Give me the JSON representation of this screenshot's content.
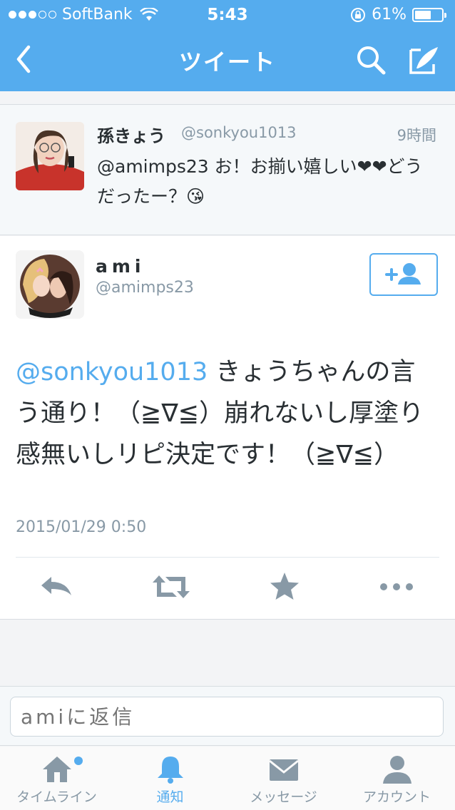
{
  "status_bar": {
    "carrier": "SoftBank",
    "time": "5:43",
    "battery": "61%",
    "battery_level": 0.61
  },
  "nav": {
    "title": "ツイート"
  },
  "reply_tweet": {
    "name": "孫きょう",
    "handle": "@sonkyou1013",
    "time": "9時間",
    "text": "@amimps23 お！お揃い嬉しい❤❤どうだったー？😘"
  },
  "main_tweet": {
    "name": "ami",
    "handle": "@amimps23",
    "mention": "@sonkyou1013",
    "text": " きょうちゃんの言う通り！（≧∇≦）崩れないし厚塗り感無いしリピ決定です！（≧∇≦）",
    "date": "2015/01/29 0:50"
  },
  "reply_input": {
    "placeholder": "amiに返信"
  },
  "tabs": [
    {
      "label": "タイムライン"
    },
    {
      "label": "通知"
    },
    {
      "label": "メッセージ"
    },
    {
      "label": "アカウント"
    }
  ],
  "colors": {
    "accent": "#55acee",
    "header": "#55acee",
    "text": "#292f33",
    "muted": "#8899a6"
  }
}
